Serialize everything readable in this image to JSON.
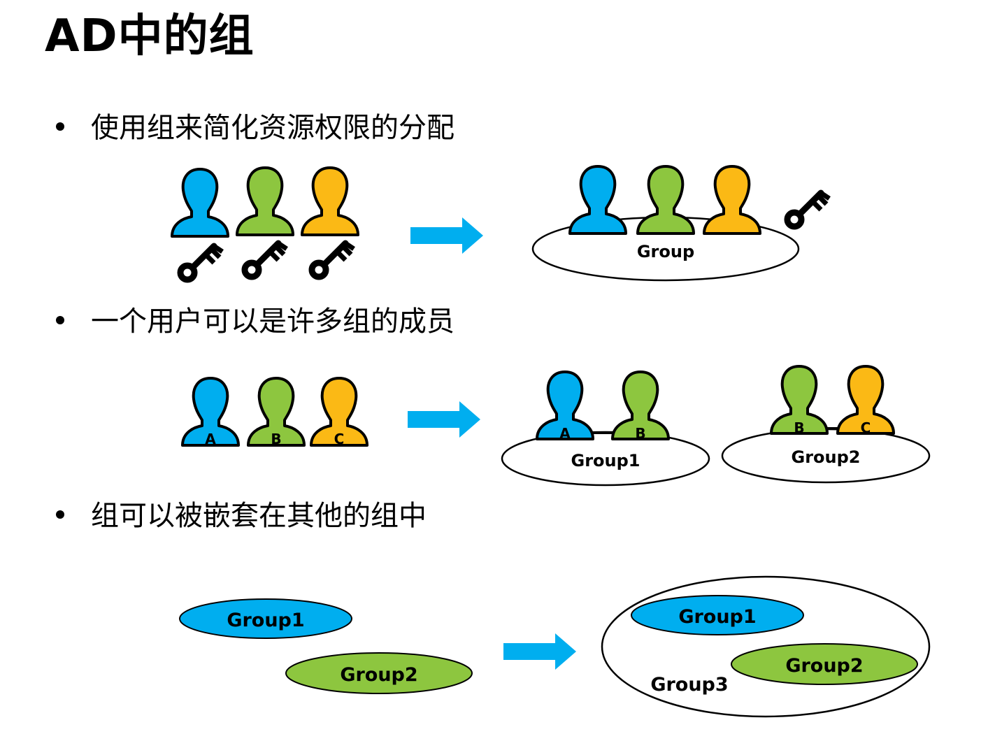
{
  "title": "AD中的组",
  "bullets": [
    "使用组来简化资源权限的分配",
    "一个用户可以是许多组的成员",
    "组可以被嵌套在其他的组中"
  ],
  "diagram1": {
    "group_label": "Group"
  },
  "diagram2": {
    "users": [
      "A",
      "B",
      "C"
    ],
    "group1_label": "Group1",
    "group2_label": "Group2"
  },
  "diagram3": {
    "group1_label": "Group1",
    "group2_label": "Group2",
    "group3_label": "Group3"
  },
  "colors": {
    "blue": "#00aeef",
    "green": "#8dc63f",
    "orange": "#fbb915",
    "arrow": "#00aeef"
  }
}
